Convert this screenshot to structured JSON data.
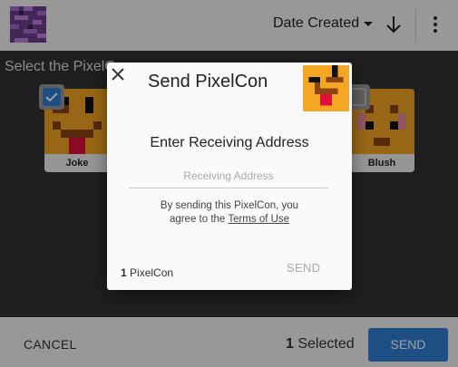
{
  "header": {
    "sort_label": "Date Created",
    "sort_dropdown_icon": "caret-down-icon",
    "sort_direction_icon": "arrow-down-icon",
    "more_icon": "more-vert-icon"
  },
  "panel": {
    "title": "Select the PixelCons",
    "cards": [
      {
        "name": "Joke",
        "selected": true
      },
      {
        "name": "Blush",
        "selected": false
      }
    ]
  },
  "footer": {
    "cancel_label": "CANCEL",
    "selected_count": "1",
    "selected_label": "Selected",
    "send_label": "SEND"
  },
  "modal": {
    "close_icon": "close-icon",
    "title": "Send PixelCon",
    "subtitle": "Enter Receiving Address",
    "address_placeholder": "Receiving Address",
    "address_value": "",
    "note_line1": "By sending this PixelCon, you",
    "note_line2_prefix": "agree to the ",
    "terms_link": "Terms of Use",
    "count": "1",
    "count_label": "PixelCon",
    "send_label": "SEND"
  },
  "colors": {
    "accent": "#2f7fd6",
    "panel_bg": "#323232",
    "pixelcon_yellow": "#f5a623",
    "pixelcon_brown": "#8b4513",
    "pixelcon_red": "#e0103c"
  }
}
